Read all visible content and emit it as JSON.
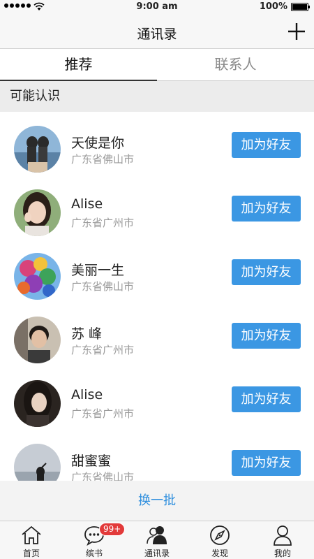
{
  "status_bar": {
    "time": "9:00 am",
    "battery": "100%"
  },
  "nav": {
    "title": "通讯录",
    "add_icon": "plus-icon"
  },
  "tabs": [
    {
      "label": "推荐",
      "active": true
    },
    {
      "label": "联系人",
      "active": false
    }
  ],
  "section_header": "可能认识",
  "contacts": [
    {
      "name": "天使是你",
      "region": "广东省佛山市",
      "action": "加为好友"
    },
    {
      "name": "Alise",
      "region": "广东省广州市",
      "action": "加为好友"
    },
    {
      "name": "美丽一生",
      "region": "广东省佛山市",
      "action": "加为好友"
    },
    {
      "name": "苏 峰",
      "region": "广东省广州市",
      "action": "加为好友"
    },
    {
      "name": "Alise",
      "region": "广东省广州市",
      "action": "加为好友"
    },
    {
      "name": "甜蜜蜜",
      "region": "广东省佛山市",
      "action": "加为好友"
    }
  ],
  "refresh_label": "换一批",
  "tabbar": [
    {
      "label": "首页",
      "icon": "home-icon"
    },
    {
      "label": "缤书",
      "icon": "chat-icon",
      "badge": "99+"
    },
    {
      "label": "通讯录",
      "icon": "contacts-icon"
    },
    {
      "label": "发现",
      "icon": "compass-icon"
    },
    {
      "label": "我的",
      "icon": "profile-icon"
    }
  ],
  "colors": {
    "accent": "#3b97e3",
    "link": "#2f8fde",
    "badge": "#e23a3a"
  }
}
